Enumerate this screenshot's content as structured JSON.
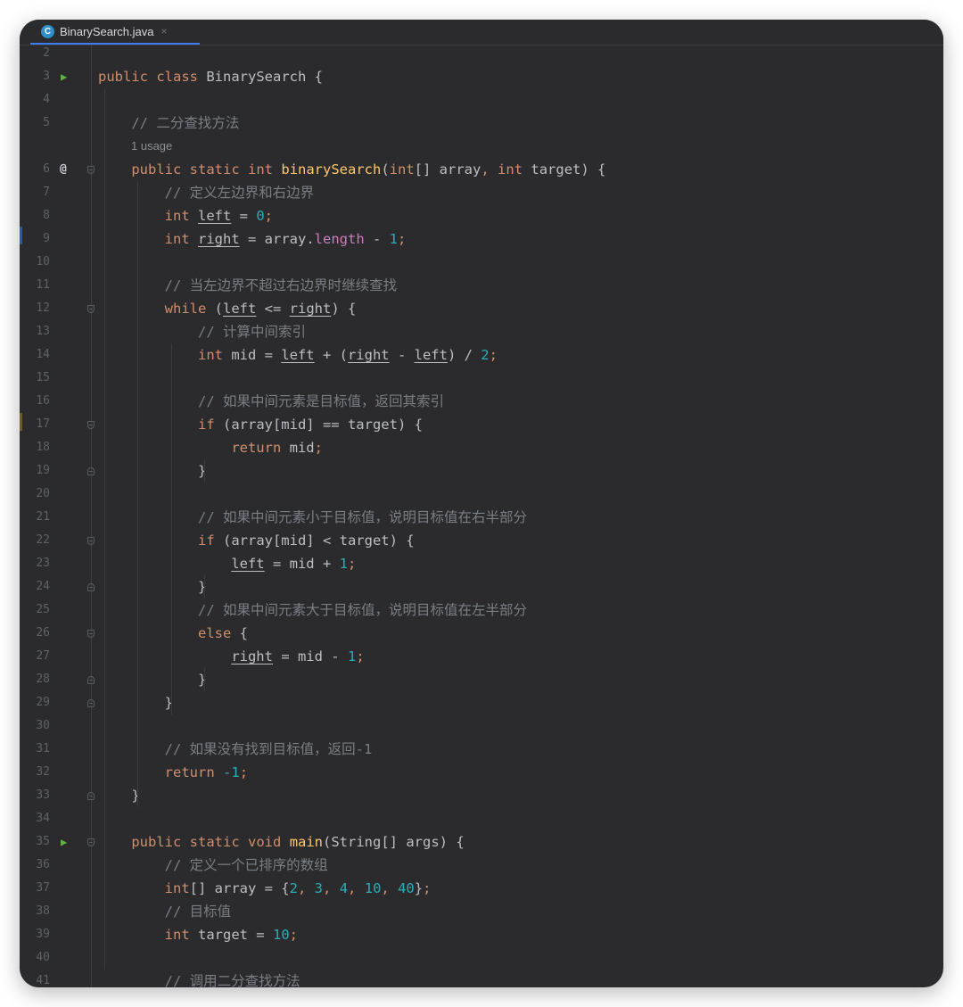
{
  "tab": {
    "icon": "java-class-icon",
    "icon_letter": "C",
    "filename": "BinarySearch.java",
    "close": "×"
  },
  "lines": [
    {
      "n": "2",
      "code": ""
    },
    {
      "n": "3",
      "code": "public class BinarySearch {",
      "run": true
    },
    {
      "n": "4",
      "code": ""
    },
    {
      "n": "5",
      "code": "    // 二分查找方法"
    },
    {
      "n": "",
      "code": "",
      "inlay": "1 usage"
    },
    {
      "n": "6",
      "code": "    public static int binarySearch(int[] array, int target) {",
      "at": true,
      "fold": "start"
    },
    {
      "n": "7",
      "code": "        // 定义左边界和右边界"
    },
    {
      "n": "8",
      "code": "        int left = 0;"
    },
    {
      "n": "9",
      "code": "        int right = array.length - 1;"
    },
    {
      "n": "10",
      "code": ""
    },
    {
      "n": "11",
      "code": "        // 当左边界不超过右边界时继续查找"
    },
    {
      "n": "12",
      "code": "        while (left <= right) {",
      "fold": "start"
    },
    {
      "n": "13",
      "code": "            // 计算中间索引"
    },
    {
      "n": "14",
      "code": "            int mid = left + (right - left) / 2;"
    },
    {
      "n": "15",
      "code": ""
    },
    {
      "n": "16",
      "code": "            // 如果中间元素是目标值，返回其索引"
    },
    {
      "n": "17",
      "code": "            if (array[mid] == target) {",
      "fold": "start"
    },
    {
      "n": "18",
      "code": "                return mid;"
    },
    {
      "n": "19",
      "code": "            }",
      "fold": "end"
    },
    {
      "n": "20",
      "code": ""
    },
    {
      "n": "21",
      "code": "            // 如果中间元素小于目标值，说明目标值在右半部分"
    },
    {
      "n": "22",
      "code": "            if (array[mid] < target) {",
      "fold": "start"
    },
    {
      "n": "23",
      "code": "                left = mid + 1;"
    },
    {
      "n": "24",
      "code": "            }",
      "fold": "end"
    },
    {
      "n": "25",
      "code": "            // 如果中间元素大于目标值，说明目标值在左半部分"
    },
    {
      "n": "26",
      "code": "            else {",
      "fold": "start"
    },
    {
      "n": "27",
      "code": "                right = mid - 1;"
    },
    {
      "n": "28",
      "code": "            }",
      "fold": "end"
    },
    {
      "n": "29",
      "code": "        }",
      "fold": "end"
    },
    {
      "n": "30",
      "code": ""
    },
    {
      "n": "31",
      "code": "        // 如果没有找到目标值，返回-1"
    },
    {
      "n": "32",
      "code": "        return -1;"
    },
    {
      "n": "33",
      "code": "    }",
      "fold": "end"
    },
    {
      "n": "34",
      "code": ""
    },
    {
      "n": "35",
      "code": "    public static void main(String[] args) {",
      "run": true,
      "fold": "start"
    },
    {
      "n": "36",
      "code": "        // 定义一个已排序的数组"
    },
    {
      "n": "37",
      "code": "        int[] array = {2, 3, 4, 10, 40};"
    },
    {
      "n": "38",
      "code": "        // 目标值"
    },
    {
      "n": "39",
      "code": "        int target = 10;"
    },
    {
      "n": "40",
      "code": ""
    },
    {
      "n": "41",
      "code": "        // 调用二分查找方法"
    }
  ],
  "colors": {
    "background": "#2b2b2d",
    "keyword": "#cf8e6d",
    "method_declaration": "#56a8f5",
    "method_main": "#ffc66d",
    "number": "#2aacb8",
    "comment": "#7a7e85",
    "field": "#c77dbb",
    "text": "#bcbec4"
  },
  "tokens": {
    "keywords": [
      "public",
      "class",
      "static",
      "int",
      "void",
      "while",
      "if",
      "else",
      "return"
    ],
    "underlined_vars": [
      "left",
      "right"
    ]
  }
}
